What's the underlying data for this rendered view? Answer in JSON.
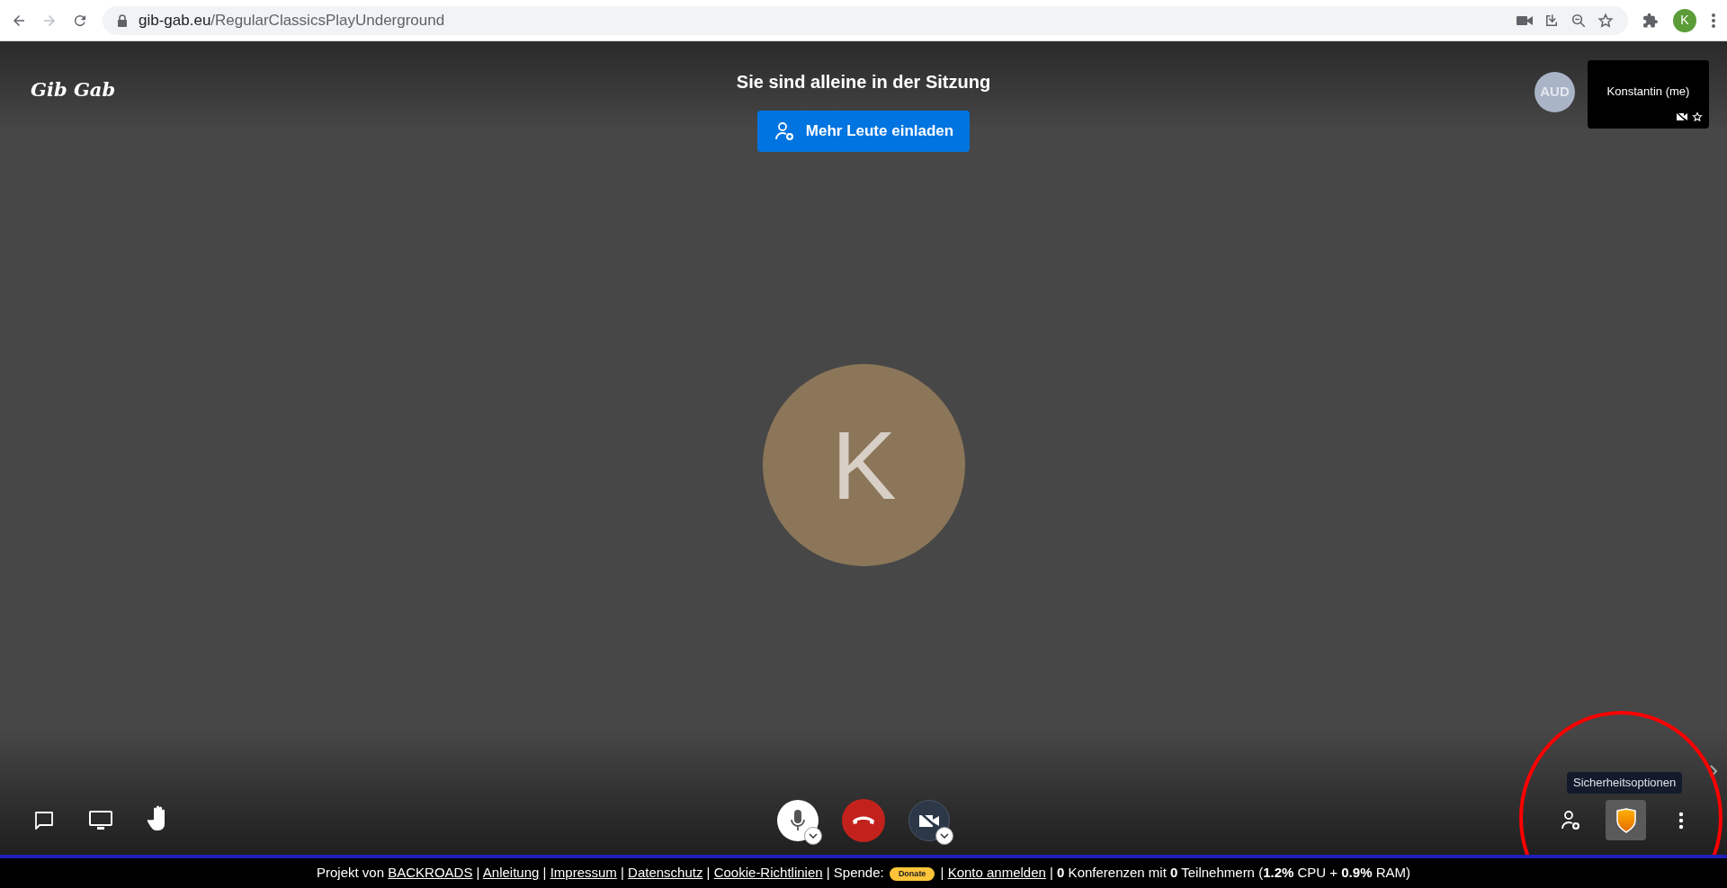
{
  "browser": {
    "url_host": "gib-gab.eu",
    "url_path": "/RegularClassicsPlayUnderground",
    "profile_initial": "K"
  },
  "meeting": {
    "logo": "Gib Gab",
    "status_title": "Sie sind alleine in der Sitzung",
    "invite_button": "Mehr Leute einladen",
    "avatar_initial": "K",
    "audio_badge": "AUD",
    "self_view": {
      "name": "Konstantin (me)"
    },
    "tooltip": "Sicherheitsoptionen",
    "toolbar": {
      "mic_muted": false,
      "camera_muted": true,
      "security_selected": true
    }
  },
  "footer": [
    {
      "kind": "text",
      "text": "Projekt von "
    },
    {
      "kind": "link",
      "text": "BACKROADS"
    },
    {
      "kind": "text",
      "text": " | "
    },
    {
      "kind": "link",
      "text": "Anleitung"
    },
    {
      "kind": "text",
      "text": " | "
    },
    {
      "kind": "link",
      "text": "Impressum"
    },
    {
      "kind": "text",
      "text": " | "
    },
    {
      "kind": "link",
      "text": "Datenschutz"
    },
    {
      "kind": "text",
      "text": " | "
    },
    {
      "kind": "link",
      "text": "Cookie-Richtlinien"
    },
    {
      "kind": "text",
      "text": " | Spende: "
    },
    {
      "kind": "donate",
      "text": "Donate"
    },
    {
      "kind": "text",
      "text": " | "
    },
    {
      "kind": "link",
      "text": "Konto anmelden"
    },
    {
      "kind": "text",
      "text": " | **0** Konferenzen mit **0** Teilnehmern (**1.2%** CPU + **0.9%** RAM)"
    }
  ]
}
